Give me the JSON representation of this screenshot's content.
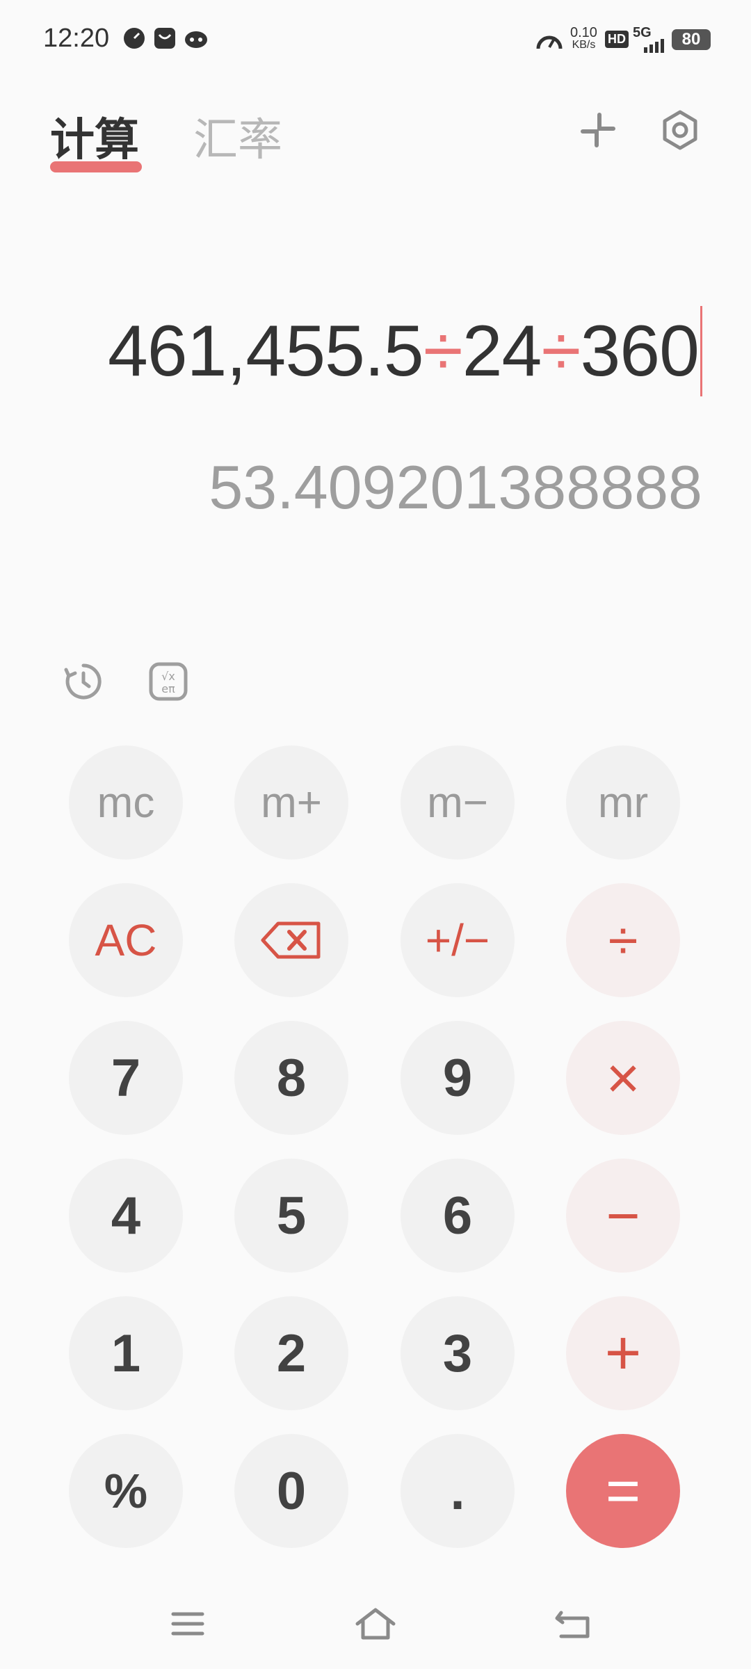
{
  "status": {
    "time": "12:20",
    "net_speed": "0.10",
    "net_unit": "KB/s",
    "hd": "HD",
    "network": "5G",
    "battery": "80"
  },
  "tabs": [
    {
      "label": "计算"
    },
    {
      "label": "汇率"
    }
  ],
  "display": {
    "expression_parts": [
      "461,455.5",
      "÷",
      "24",
      "÷",
      "360"
    ],
    "result": "53.409201388888"
  },
  "keys": {
    "mc": "mc",
    "mplus": "m+",
    "mminus": "m−",
    "mr": "mr",
    "ac": "AC",
    "sign": "+/−",
    "divide": "÷",
    "seven": "7",
    "eight": "8",
    "nine": "9",
    "multiply": "×",
    "four": "4",
    "five": "5",
    "six": "6",
    "minus": "−",
    "one": "1",
    "two": "2",
    "three": "3",
    "plus": "+",
    "percent": "%",
    "zero": "0",
    "dot": ".",
    "equals": "="
  },
  "colors": {
    "accent": "#e97475",
    "operator_text": "#d75446",
    "key_bg": "#f1f1f1"
  }
}
